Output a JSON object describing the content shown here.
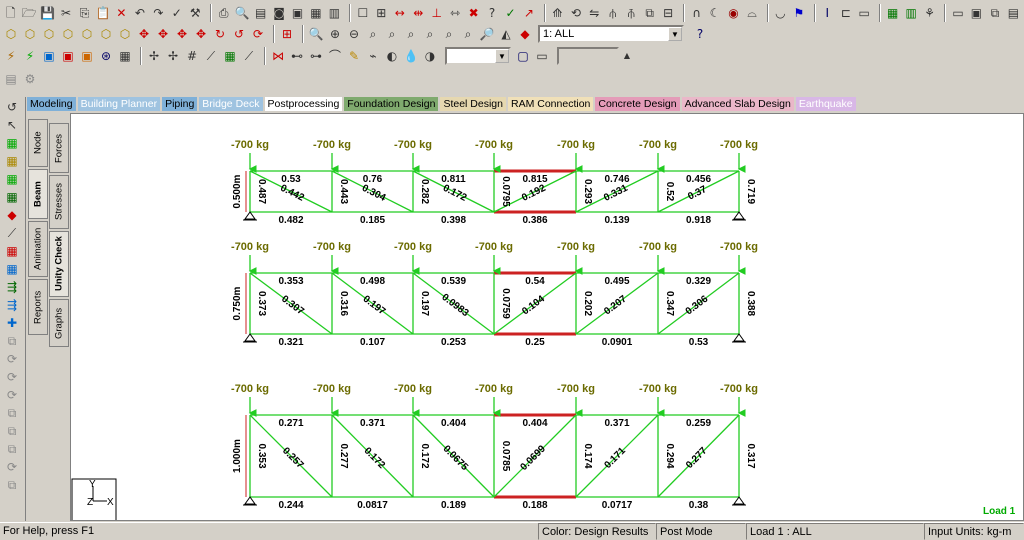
{
  "toolbars": {
    "load_select": "1: ALL",
    "small_select": "",
    "spin_value": ""
  },
  "mode_tabs": [
    {
      "label": "Modeling",
      "color": "#7fb0d8"
    },
    {
      "label": "Building Planner",
      "color": "#9fc3e0"
    },
    {
      "label": "Piping",
      "color": "#7fb0d8"
    },
    {
      "label": "Bridge Deck",
      "color": "#9fc3e0"
    },
    {
      "label": "Postprocessing",
      "color": "#ffffff"
    },
    {
      "label": "Foundation Design",
      "color": "#7faa6e"
    },
    {
      "label": "Steel Design",
      "color": "#e6d8b0"
    },
    {
      "label": "RAM Connection",
      "color": "#f0e0b8"
    },
    {
      "label": "Concrete Design",
      "color": "#e49bb8"
    },
    {
      "label": "Advanced Slab Design",
      "color": "#eab7c9"
    },
    {
      "label": "Earthquake",
      "color": "#d8b7e6"
    }
  ],
  "side_tabs": {
    "inner": [
      {
        "label": "Node"
      },
      {
        "label": "Beam"
      },
      {
        "label": "Animation"
      },
      {
        "label": "Reports"
      }
    ],
    "outer": [
      {
        "label": "Forces"
      },
      {
        "label": "Stresses"
      },
      {
        "label": "Unity Check"
      },
      {
        "label": "Graphs"
      }
    ]
  },
  "colors": {
    "member": "#22cc22",
    "load": "#22cc22",
    "fail": "#cc2222",
    "load_text": "#6b6b00",
    "dim": "#cc2222",
    "load_case_label": "#00aa00"
  },
  "trusses": [
    {
      "height_label": "0.500m",
      "top_chords": [
        "0.53",
        "0.76",
        "0.811",
        "0.815",
        "0.746",
        "0.456"
      ],
      "bottom_chords": [
        "0.482",
        "0.185",
        "0.398",
        "0.386",
        "0.139",
        "0.918"
      ],
      "verticals": [
        "0.487",
        "0.443",
        "0.282",
        "0.0795",
        "0.293",
        "0.52",
        "0.719"
      ],
      "diagonals": [
        "0.442",
        "0.304",
        "0.172",
        "0.192",
        "0.331",
        "0.37"
      ]
    },
    {
      "height_label": "0.750m",
      "top_chords": [
        "0.353",
        "0.498",
        "0.539",
        "0.54",
        "0.495",
        "0.329"
      ],
      "bottom_chords": [
        "0.321",
        "0.107",
        "0.253",
        "0.25",
        "0.0901",
        "0.53"
      ],
      "verticals": [
        "0.373",
        "0.316",
        "0.197",
        "0.0759",
        "0.202",
        "0.347",
        "0.388"
      ],
      "diagonals": [
        "0.307",
        "0.197",
        "0.0983",
        "0.104",
        "0.207",
        "0.306"
      ]
    },
    {
      "height_label": "1.000m",
      "top_chords": [
        "0.271",
        "0.371",
        "0.404",
        "0.404",
        "0.371",
        "0.259"
      ],
      "bottom_chords": [
        "0.244",
        "0.0817",
        "0.189",
        "0.188",
        "0.0717",
        "0.38"
      ],
      "verticals": [
        "0.353",
        "0.277",
        "0.172",
        "0.0785",
        "0.174",
        "0.294",
        "0.317"
      ],
      "diagonals": [
        "0.257",
        "0.172",
        "0.0675",
        "0.0699",
        "0.171",
        "0.277"
      ]
    }
  ],
  "load_label": "-700 kg",
  "load_case_label": "Load 1",
  "axis": {
    "y": "Y",
    "z": "Z",
    "x": "X"
  },
  "status": {
    "help": "For Help, press F1",
    "color_mode": "Color: Design Results",
    "mode": "Post Mode",
    "load": "Load 1 : ALL",
    "units_label": "Input Units:",
    "units_value": "kg-m"
  }
}
